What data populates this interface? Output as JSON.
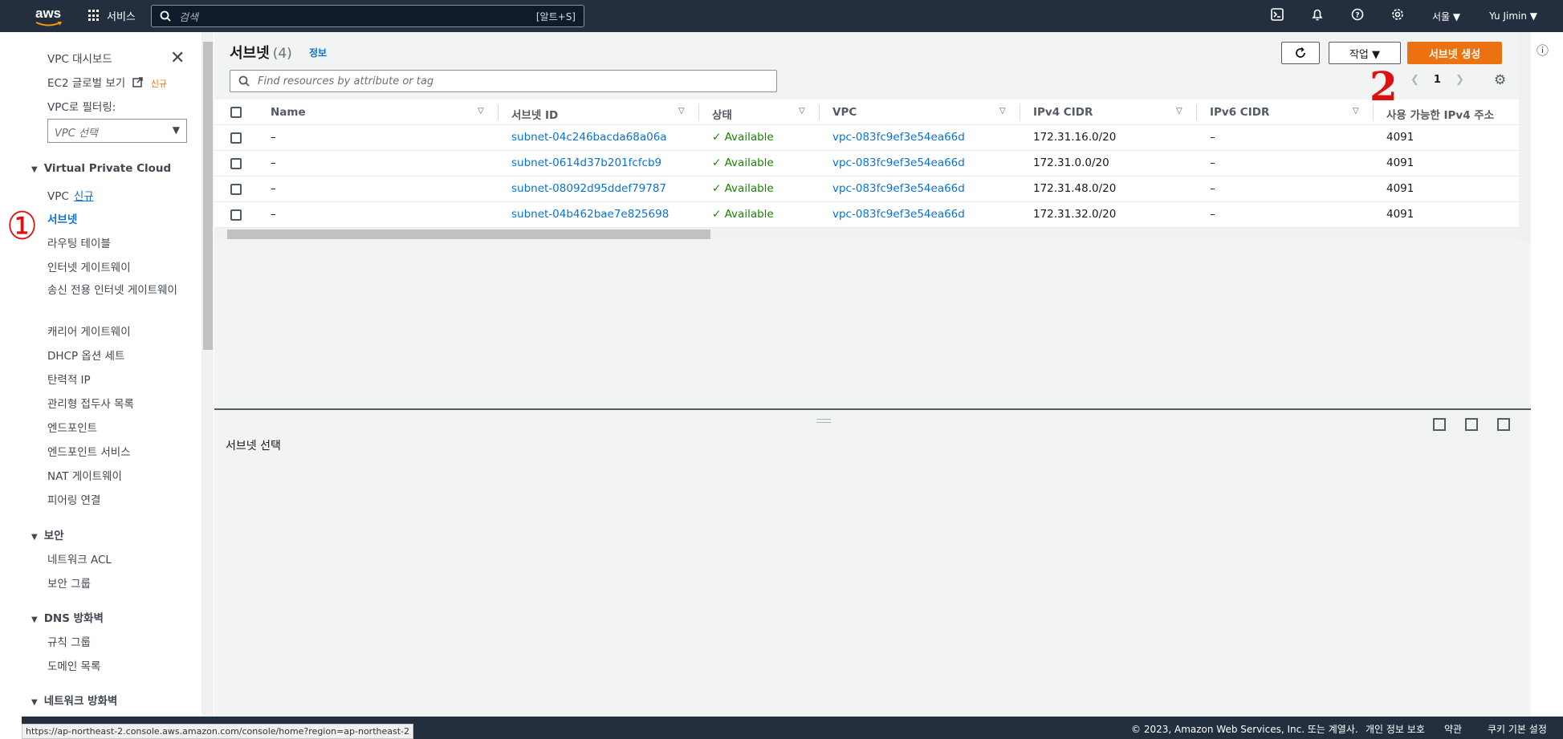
{
  "topbar": {
    "logo": "aws",
    "services_label": "서비스",
    "search_placeholder": "검색",
    "search_shortcut": "[알트+S]",
    "region": "서울 ▼",
    "user": "Yu Jimin ▼"
  },
  "sidebar": {
    "dashboard": "VPC 대시보드",
    "ec2_global": "EC2 글로벌 보기",
    "ec2_global_tag": "신규",
    "filter_label": "VPC로 필터링:",
    "vpc_select_placeholder": "VPC 선택",
    "sections": [
      {
        "title": "Virtual Private Cloud"
      },
      {
        "title": "보안"
      },
      {
        "title": "DNS 방화벽"
      },
      {
        "title": "네트워크 방화벽"
      }
    ],
    "vpc_items": {
      "vpc": "VPC",
      "vpc_tag": "신규",
      "subnets": "서브넷",
      "route_tables": "라우팅 테이블",
      "igw": "인터넷 게이트웨이",
      "eigw": "송신 전용 인터넷 게이트웨이",
      "cgw": "캐리어 게이트웨이",
      "dhcp": "DHCP 옵션 세트",
      "eip": "탄력적 IP",
      "managed_prefix": "관리형 접두사 목록",
      "endpoints": "엔드포인트",
      "endpoint_services": "엔드포인트 서비스",
      "nat": "NAT 게이트웨이",
      "peering": "피어링 연결"
    },
    "security_items": {
      "nacl": "네트워크 ACL",
      "sg": "보안 그룹"
    },
    "dns_items": {
      "rule_groups": "규칙 그룹",
      "domain_lists": "도메인 목록"
    }
  },
  "annotations": {
    "mark1": "①",
    "mark2": "2"
  },
  "main": {
    "title": "서브넷",
    "count": "(4)",
    "info": "정보",
    "actions_label": "작업 ▼",
    "create_label": "서브넷 생성",
    "filter_placeholder": "Find resources by attribute or tag",
    "page_number": "1",
    "columns": [
      "Name",
      "서브넷 ID",
      "상태",
      "VPC",
      "IPv4 CIDR",
      "IPv6 CIDR",
      "사용 가능한 IPv4 주소"
    ],
    "rows": [
      {
        "name": "–",
        "subnet_id": "subnet-04c246bacda68a06a",
        "state": "Available",
        "vpc": "vpc-083fc9ef3e54ea66d",
        "ipv4": "172.31.16.0/20",
        "ipv6": "–",
        "avail": "4091"
      },
      {
        "name": "–",
        "subnet_id": "subnet-0614d37b201fcfcb9",
        "state": "Available",
        "vpc": "vpc-083fc9ef3e54ea66d",
        "ipv4": "172.31.0.0/20",
        "ipv6": "–",
        "avail": "4091"
      },
      {
        "name": "–",
        "subnet_id": "subnet-08092d95ddef79787",
        "state": "Available",
        "vpc": "vpc-083fc9ef3e54ea66d",
        "ipv4": "172.31.48.0/20",
        "ipv6": "–",
        "avail": "4091"
      },
      {
        "name": "–",
        "subnet_id": "subnet-04b462bae7e825698",
        "state": "Available",
        "vpc": "vpc-083fc9ef3e54ea66d",
        "ipv4": "172.31.32.0/20",
        "ipv6": "–",
        "avail": "4091"
      }
    ],
    "detail_title": "서브넷 선택"
  },
  "footer": {
    "copyright": "© 2023, Amazon Web Services, Inc. 또는 계열사.",
    "privacy": "개인 정보 보호",
    "terms": "약관",
    "cookies": "쿠키 기본 설정"
  },
  "status_url": "https://ap-northeast-2.console.aws.amazon.com/console/home?region=ap-northeast-2",
  "colors": {
    "header_bg": "#232f3e",
    "primary": "#ec7211",
    "link": "#0972d3",
    "success": "#1d8102",
    "annotation": "#e01010"
  }
}
